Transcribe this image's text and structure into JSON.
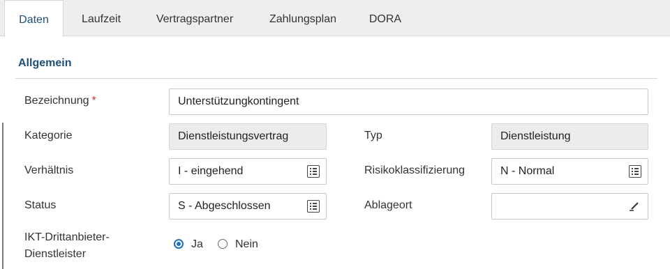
{
  "tabs": [
    {
      "label": "Daten",
      "active": true
    },
    {
      "label": "Laufzeit",
      "active": false
    },
    {
      "label": "Vertragspartner",
      "active": false
    },
    {
      "label": "Zahlungsplan",
      "active": false
    },
    {
      "label": "DORA",
      "active": false
    }
  ],
  "section": {
    "title": "Allgemein"
  },
  "form": {
    "bezeichnung": {
      "label": "Bezeichnung",
      "required_mark": "*",
      "value": "Unterstützungkontingent"
    },
    "kategorie": {
      "label": "Kategorie",
      "value": "Dienstleistungsvertrag"
    },
    "typ": {
      "label": "Typ",
      "value": "Dienstleistung"
    },
    "verhaeltnis": {
      "label": "Verhältnis",
      "value": "I - eingehend"
    },
    "risikoklassifizierung": {
      "label": "Risikoklassifizierung",
      "value": "N - Normal"
    },
    "status": {
      "label": "Status",
      "value": "S - Abgeschlossen"
    },
    "ablageort": {
      "label": "Ablageort",
      "value": ""
    },
    "ikt": {
      "label_line1": "IKT-Drittanbieter-",
      "label_line2": "Dienstleister",
      "options": [
        {
          "label": "Ja",
          "selected": true
        },
        {
          "label": "Nein",
          "selected": false
        }
      ]
    }
  },
  "colors": {
    "accent": "#1f4e79",
    "radio": "#1f6fc5",
    "required": "#c0392b"
  },
  "icons": {
    "list": "list-select-icon",
    "edit": "pencil-icon"
  }
}
